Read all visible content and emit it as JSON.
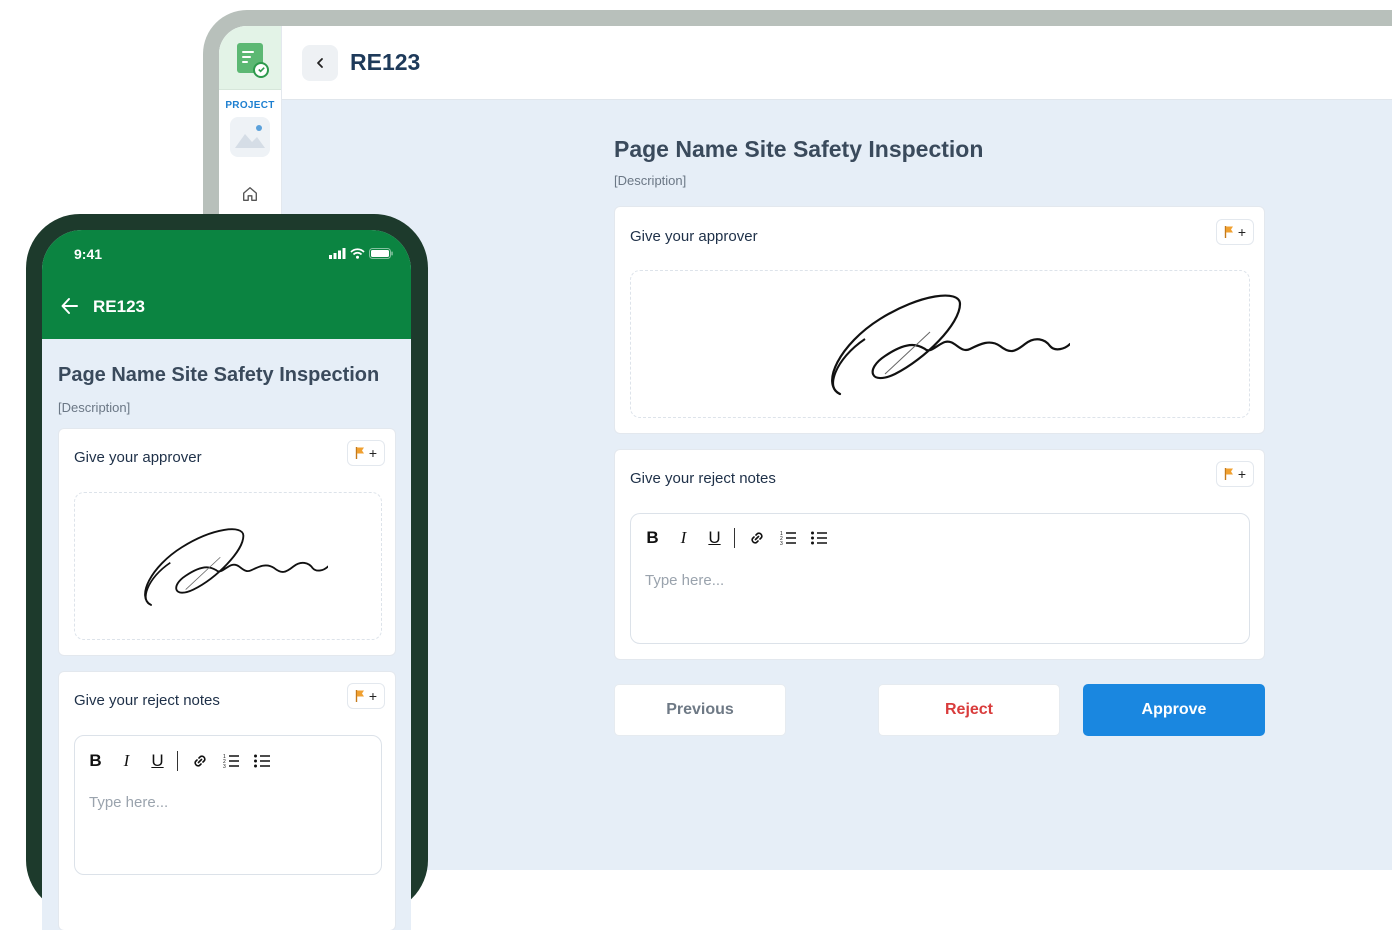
{
  "desktop": {
    "sidebar": {
      "project_label": "PROJECT"
    },
    "header": {
      "title": "RE123"
    },
    "page": {
      "title": "Page Name Site Safety Inspection",
      "description": "[Description]"
    },
    "approver": {
      "label": "Give your approver",
      "flag_plus": "+"
    },
    "reject_notes": {
      "label": "Give your reject notes",
      "flag_plus": "+",
      "placeholder": "Type here...",
      "toolbar": {
        "bold": "B",
        "italic": "I",
        "underline": "U"
      }
    },
    "buttons": {
      "previous": "Previous",
      "reject": "Reject",
      "approve": "Approve"
    }
  },
  "mobile": {
    "status_time": "9:41",
    "header": {
      "title": "RE123"
    },
    "page": {
      "title": "Page Name Site Safety Inspection",
      "description": "[Description]"
    },
    "approver": {
      "label": "Give your approver",
      "flag_plus": "+"
    },
    "reject_notes": {
      "label": "Give your reject notes",
      "flag_plus": "+",
      "placeholder": "Type here...",
      "toolbar": {
        "bold": "B",
        "italic": "I",
        "underline": "U"
      }
    }
  },
  "colors": {
    "primary": "#1a87e0",
    "reject": "#d93c3c",
    "mobile_header": "#0b8441",
    "flag": "#f0a030"
  }
}
